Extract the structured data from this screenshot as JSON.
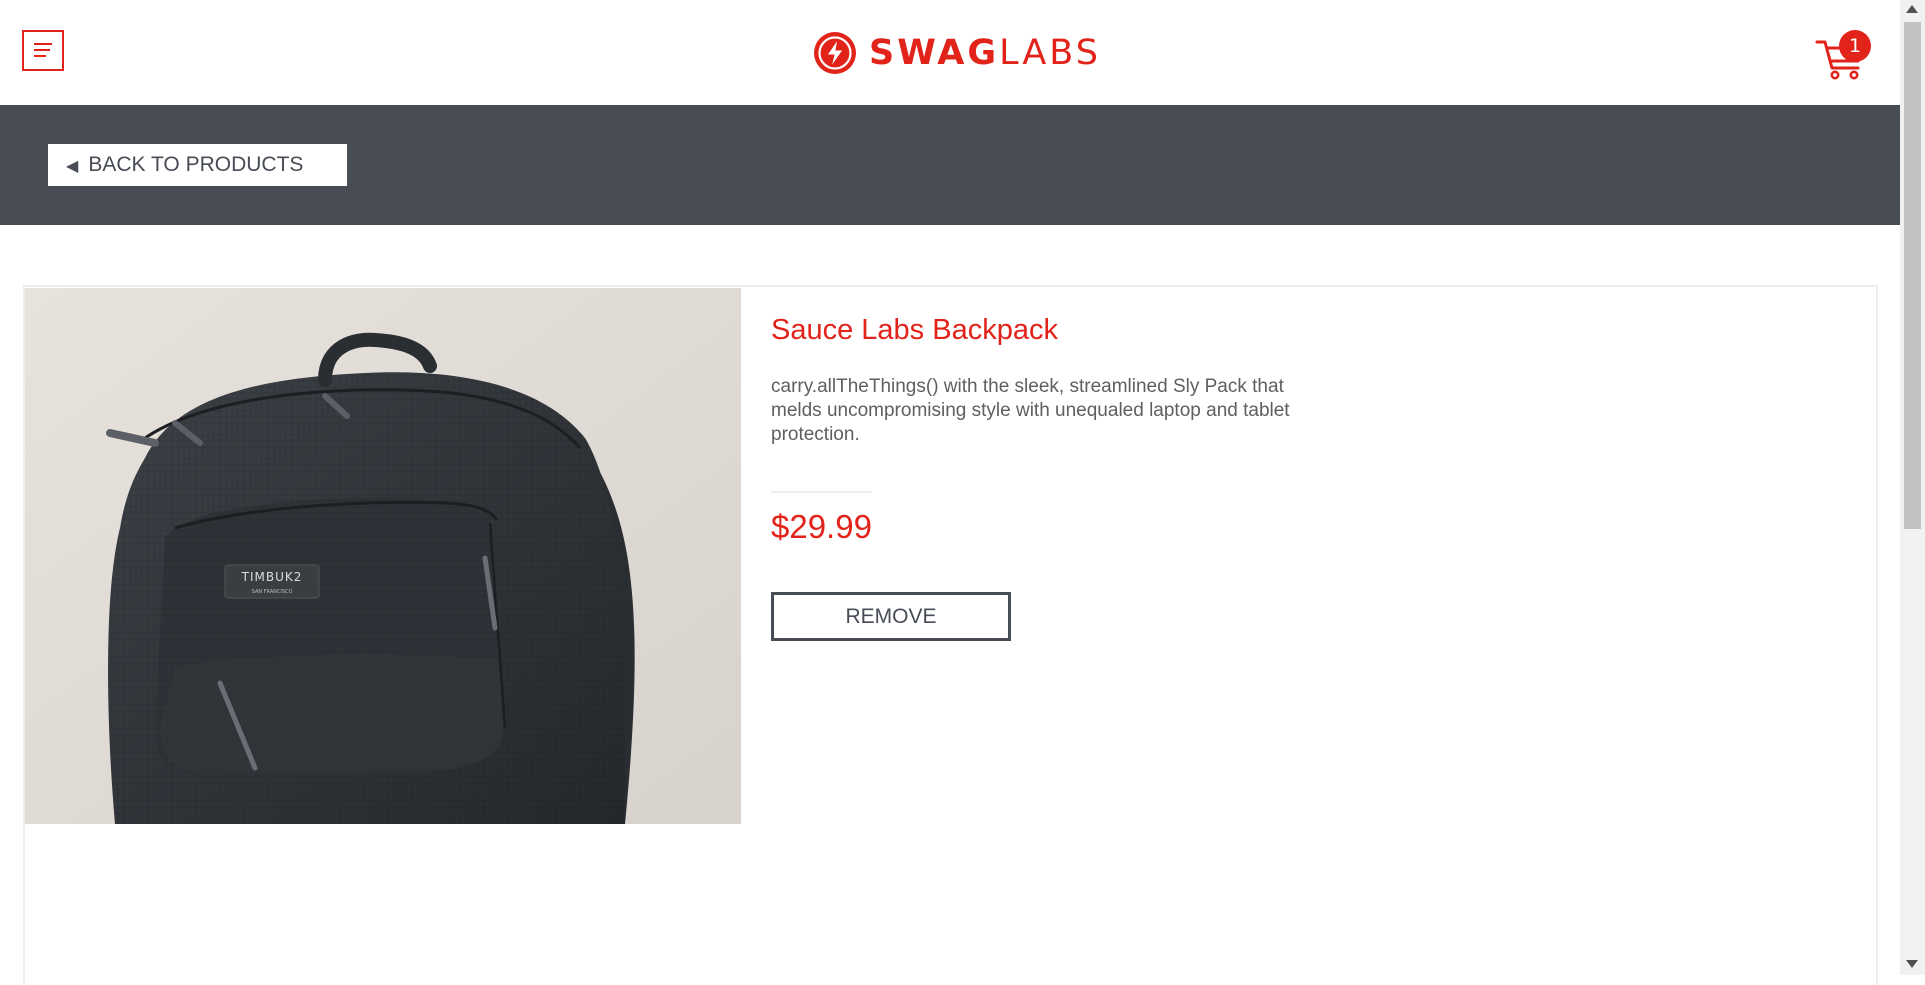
{
  "header": {
    "logo": {
      "bold": "SWAG",
      "light": "LABS"
    },
    "cart": {
      "count": "1"
    },
    "menu_icon": "hamburger-menu-icon"
  },
  "subheader": {
    "back_button": {
      "arrow": "◀",
      "label": "BACK TO PRODUCTS"
    }
  },
  "product": {
    "name": "Sauce Labs Backpack",
    "description": "carry.allTheThings() with the sleek, streamlined Sly Pack that melds uncompromising style with unequaled laptop and tablet protection.",
    "price": "$29.99",
    "remove_label": "REMOVE",
    "image_brand_label": "TIMBUK2",
    "image_brand_sub": "SAN FRANCISCO"
  },
  "colors": {
    "accent": "#e2231a",
    "subheader_bg": "#474c55",
    "description_text": "#5f5f5f"
  }
}
